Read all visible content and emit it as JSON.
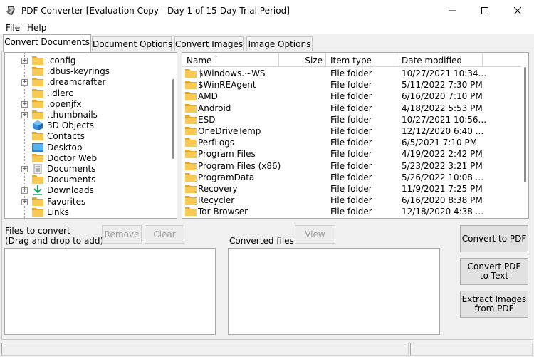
{
  "window": {
    "title": "PDF Converter [Evaluation Copy - Day 1 of 15-Day Trial Period]",
    "icon": "pdf-converter-app-icon",
    "minimize_icon": "minimize-icon",
    "maximize_icon": "maximize-icon",
    "close_icon": "close-icon"
  },
  "menu": {
    "items": [
      "File",
      "Help"
    ]
  },
  "tabs": [
    {
      "label": "Convert Documents",
      "active": true
    },
    {
      "label": "Document Options",
      "active": false
    },
    {
      "label": "Convert Images",
      "active": false
    },
    {
      "label": "Image Options",
      "active": false
    }
  ],
  "tree": {
    "items": [
      {
        "label": ".config",
        "icon": "folder-icon",
        "expandable": true
      },
      {
        "label": ".dbus-keyrings",
        "icon": "folder-icon",
        "expandable": false
      },
      {
        "label": ".dreamcrafter",
        "icon": "folder-icon",
        "expandable": true
      },
      {
        "label": ".idlerc",
        "icon": "folder-icon",
        "expandable": false
      },
      {
        "label": ".openjfx",
        "icon": "folder-icon",
        "expandable": true
      },
      {
        "label": ".thumbnails",
        "icon": "folder-icon",
        "expandable": true
      },
      {
        "label": "3D Objects",
        "icon": "3d-objects-icon",
        "expandable": false
      },
      {
        "label": "Contacts",
        "icon": "folder-icon",
        "expandable": false
      },
      {
        "label": "Desktop",
        "icon": "desktop-icon",
        "expandable": false
      },
      {
        "label": "Doctor Web",
        "icon": "folder-icon",
        "expandable": false
      },
      {
        "label": "Documents",
        "icon": "documents-icon",
        "expandable": true
      },
      {
        "label": "Documents",
        "icon": "folder-icon",
        "expandable": false
      },
      {
        "label": "Downloads",
        "icon": "downloads-icon",
        "expandable": true
      },
      {
        "label": "Favorites",
        "icon": "folder-icon",
        "expandable": true
      },
      {
        "label": "Links",
        "icon": "folder-icon",
        "expandable": false
      }
    ]
  },
  "file_list": {
    "columns": {
      "name": "Name",
      "size": "Size",
      "type": "Item type",
      "date": "Date modified"
    },
    "rows": [
      {
        "name": "$Windows.~WS",
        "type": "File folder",
        "date": "10/27/2021 10:34..."
      },
      {
        "name": "$WinREAgent",
        "type": "File folder",
        "date": "5/11/2022 7:30 PM"
      },
      {
        "name": "AMD",
        "type": "File folder",
        "date": "6/16/2020 7:10 PM"
      },
      {
        "name": "Android",
        "type": "File folder",
        "date": "4/18/2022 5:53 PM"
      },
      {
        "name": "ESD",
        "type": "File folder",
        "date": "10/27/2021 10:56..."
      },
      {
        "name": "OneDriveTemp",
        "type": "File folder",
        "date": "12/12/2020 6:40 ..."
      },
      {
        "name": "PerfLogs",
        "type": "File folder",
        "date": "6/5/2021 7:10 PM"
      },
      {
        "name": "Program Files",
        "type": "File folder",
        "date": "4/19/2022 2:42 PM"
      },
      {
        "name": "Program Files (x86)",
        "type": "File folder",
        "date": "5/23/2022 3:21 PM"
      },
      {
        "name": "ProgramData",
        "type": "File folder",
        "date": "5/26/2022 10:08 ..."
      },
      {
        "name": "Recovery",
        "type": "File folder",
        "date": "11/9/2021 7:25 PM"
      },
      {
        "name": "Recycler",
        "type": "File folder",
        "date": "6/16/2020 8:38 PM"
      },
      {
        "name": "Tor Browser",
        "type": "File folder",
        "date": "12/18/2020 4:38 ..."
      }
    ]
  },
  "files_to_convert": {
    "label_line1": "Files to convert",
    "label_line2": "(Drag and drop to add)",
    "remove_label": "Remove",
    "clear_label": "Clear"
  },
  "converted_files": {
    "label": "Converted files",
    "view_label": "View"
  },
  "actions": {
    "convert_to_pdf": "Convert to PDF",
    "convert_pdf_to_text_line1": "Convert PDF",
    "convert_pdf_to_text_line2": "to Text",
    "extract_images_line1": "Extract Images",
    "extract_images_line2": "from PDF"
  },
  "colors": {
    "folder": "#f8c953",
    "folder_dark": "#e5a82a"
  }
}
